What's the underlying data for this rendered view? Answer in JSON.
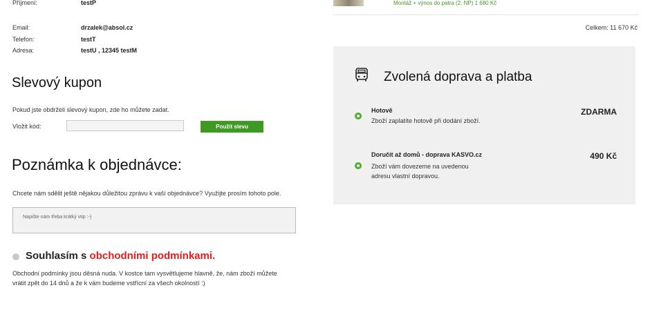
{
  "customer": {
    "surname_label": "Příjmení:",
    "surname_value": "testP",
    "email_label": "Email:",
    "email_value": "drzalek@absol.cz",
    "phone_label": "Telefon:",
    "phone_value": "testT",
    "address_label": "Adresa:",
    "address_value": "testU , 12345 testM"
  },
  "coupon": {
    "heading": "Slevový kupon",
    "hint": "Pokud jste obdrželi slevový kupon, zde ho můžete zadat.",
    "code_label": "Vložit kód:",
    "code_value": "",
    "apply_label": "Použít slevu"
  },
  "note": {
    "heading": "Poznámka k objednávce:",
    "hint": "Chcete nám sdělit ještě nějakou důležitou zprávu k vaší objednávce? Využijte prosím tohoto pole.",
    "placeholder": "Napište nám třeba krátký vtip :-)"
  },
  "terms": {
    "prefix": "Souhlasím s ",
    "link": "obchodními podmínkami.",
    "text_line1": "Obchodní podmínky jsou děsná nuda. V kostce tam vysvětlujeme hlavně, že, nám zboží můžete",
    "text_line2": "vrátit zpět do 14 dnů a že k vám budeme vstřícní za všech okolností :)"
  },
  "cart": {
    "montaz": "Montáž + výnos do patra (2. NP) 1 680 Kč",
    "total": "Celkem: 11 670 Kč"
  },
  "shipping": {
    "title": "Zvolená doprava a platba",
    "icon": "truck-icon",
    "options": [
      {
        "title": "Hotově",
        "desc_line1": "Zboží zaplatíte hotově při dodání zboží.",
        "desc_line2": "",
        "desc_line3": "",
        "price": "ZDARMA"
      },
      {
        "title": "Doručit až domů - doprava KASVO.cz",
        "desc_line1": "",
        "desc_line2": "Zboží vám dovezeme na uvedenou",
        "desc_line3": "adresu vlastní dopravou.",
        "price": "490 Kč"
      }
    ]
  },
  "colors": {
    "accent_green": "#3f9a23",
    "link_red": "#e21b1b",
    "panel_bg": "#f0f0f0"
  }
}
